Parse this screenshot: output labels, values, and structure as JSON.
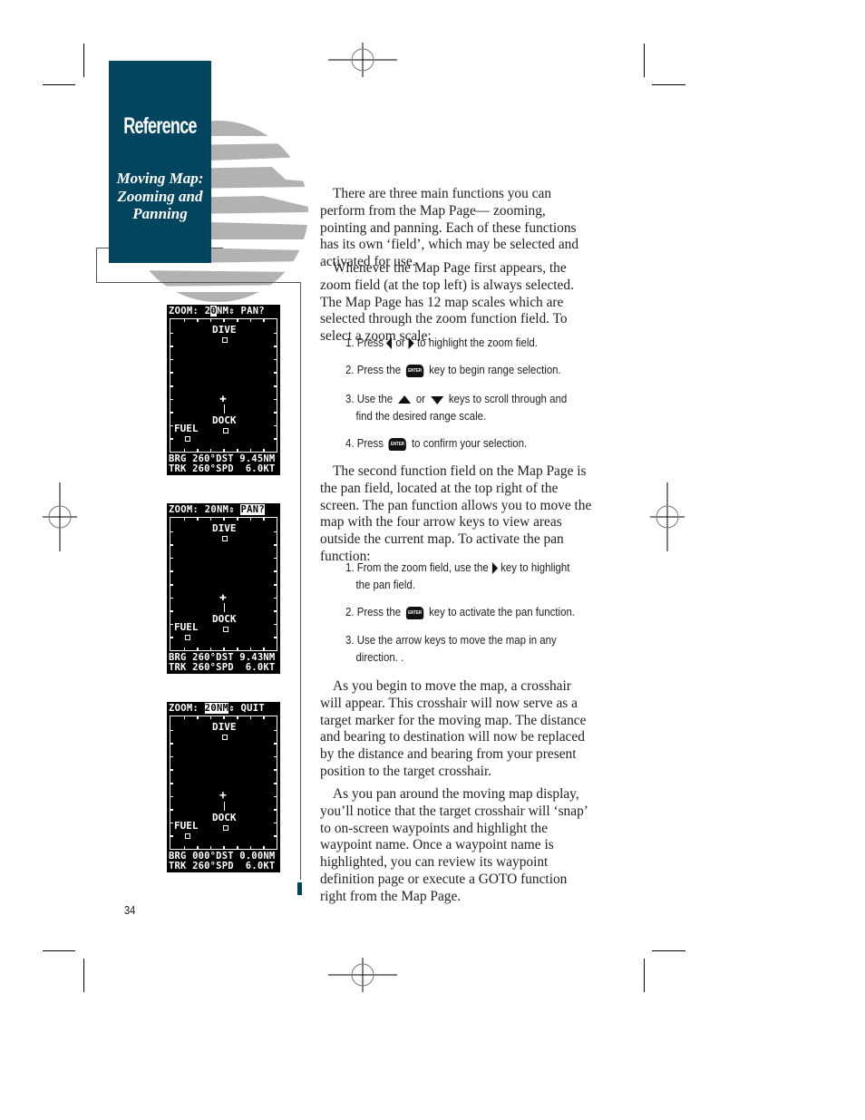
{
  "sidebar": {
    "title": "Reference",
    "subtitle_lines": [
      "Moving Map:",
      "Zooming and",
      "Panning"
    ],
    "color": "#03455e"
  },
  "screens": [
    {
      "top_zoom_label": "ZOOM:",
      "zoom_value": "20NM",
      "zoom_highlight": "digit",
      "right_field": "PAN?",
      "right_highlight": false,
      "waypoints": [
        "DIVE",
        "DOCK",
        "FUEL"
      ],
      "crosshair": "filled",
      "bottom_line1": "BRG 260°DST 9.45NM",
      "bottom_line2": "TRK 260°SPD  6.0KT"
    },
    {
      "top_zoom_label": "ZOOM:",
      "zoom_value": "20NM",
      "zoom_highlight": "none",
      "right_field": "PAN?",
      "right_highlight": true,
      "waypoints": [
        "DIVE",
        "DOCK",
        "FUEL"
      ],
      "crosshair": "filled",
      "bottom_line1": "BRG 260°DST 9.43NM",
      "bottom_line2": "TRK 260°SPD  6.0KT"
    },
    {
      "top_zoom_label": "ZOOM:",
      "zoom_value": "20NM",
      "zoom_highlight": "full",
      "right_field": "QUIT",
      "right_highlight": false,
      "waypoints": [
        "DIVE",
        "DOCK",
        "FUEL"
      ],
      "crosshair": "open",
      "bottom_line1": "BRG 000°DST 0.00NM",
      "bottom_line2": "TRK 260°SPD  6.0KT"
    }
  ],
  "body": {
    "para1": "There are three main functions you can perform from the Map Page— zooming, pointing and panning. Each of these functions has its own ‘field’, which may be selected and activated for use.",
    "para2": "Whenever the Map Page first appears, the zoom field (at the top left) is always selected. The Map Page has 12 map scales which are selected through the zoom function field. To select a zoom scale:",
    "zoom_steps": [
      {
        "num": "1.",
        "pre": "Press",
        "mid": "or",
        "post": "to highlight the zoom field."
      },
      {
        "num": "2.",
        "pre": "Press the",
        "post": "key to begin range selection."
      },
      {
        "num": "3.",
        "pre": "Use the",
        "mid": "or",
        "post": "keys to scroll through and",
        "cont": "find the desired range scale."
      },
      {
        "num": "4.",
        "pre": "Press",
        "post": "to confirm your selection."
      }
    ],
    "para3": "The second function field on the Map Page is the pan field, located at the top right of the screen. The pan function allows you to move the map with the four arrow keys to view areas outside the current map. To activate the pan function:",
    "pan_steps": [
      {
        "num": "1.",
        "pre": "From the zoom field, use the",
        "post": "key to highlight",
        "cont": "the pan field."
      },
      {
        "num": "2.",
        "pre": "Press the",
        "post": "key to activate the pan function."
      },
      {
        "num": "3.",
        "pre": "Use the arrow keys to move the map in any",
        "cont": "direction. ."
      }
    ],
    "para4": "As you begin to move the map, a crosshair will appear. This crosshair will now serve as a target marker for the moving map. The distance and bearing to destination will now be replaced by the distance and bearing from your present position to the target crosshair.",
    "para5": "As you pan around the moving map display, you’ll notice that the target crosshair will ‘snap’ to on-screen waypoints and highlight the waypoint name. Once a waypoint name is highlighted, you can review its waypoint definition page or execute a GOTO function right from the Map Page."
  },
  "keys": {
    "enter_label": "ENTER"
  },
  "page_number": "34"
}
